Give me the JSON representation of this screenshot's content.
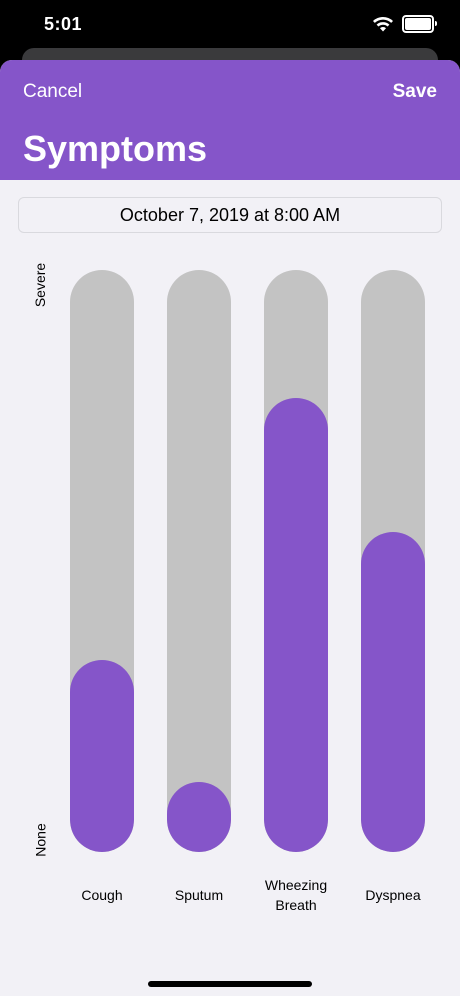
{
  "status_bar": {
    "time": "5:01"
  },
  "nav": {
    "cancel_label": "Cancel",
    "save_label": "Save",
    "title": "Symptoms"
  },
  "date": {
    "value": "October 7, 2019 at 8:00 AM"
  },
  "scale": {
    "max_label": "Severe",
    "min_label": "None"
  },
  "symptoms": [
    {
      "name": "Cough",
      "level": 0.33
    },
    {
      "name": "Sputum",
      "level": 0.12
    },
    {
      "name": "Wheezing Breath",
      "level": 0.78
    },
    {
      "name": "Dyspnea",
      "level": 0.55
    }
  ],
  "colors": {
    "accent": "#8555c9",
    "track": "#c3c3c3",
    "background": "#f2f1f6"
  }
}
